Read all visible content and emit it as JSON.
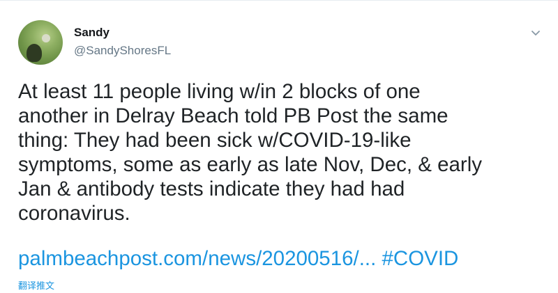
{
  "author": {
    "display_name": "Sandy",
    "handle": "@SandyShoresFL"
  },
  "tweet": {
    "text": "At least 11 people living w/in 2 blocks of one\nanother in Delray Beach told PB Post the same\nthing: They had been sick w/COVID-19-like\nsymptoms, some as early as late Nov, Dec, & early\nJan & antibody tests indicate they had had\ncoronavirus.",
    "link_text": "palmbeachpost.com/news/20200516/...",
    "hashtag": "#COVID",
    "translate_label": "翻译推文"
  },
  "icons": {
    "menu": "chevron-down-icon",
    "avatar": "avatar-image"
  },
  "colors": {
    "link": "#1b95e0",
    "secondary_text": "#657786",
    "primary_text": "#14171a"
  }
}
